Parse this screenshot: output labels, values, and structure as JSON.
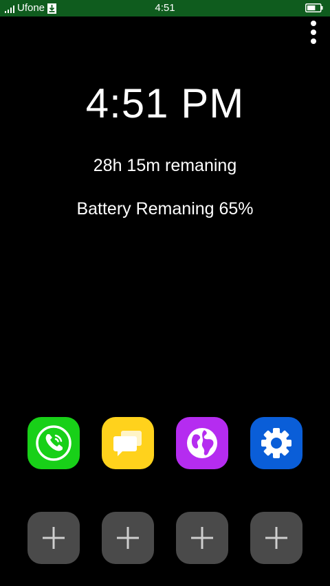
{
  "status_bar": {
    "carrier": "Ufone",
    "time": "4:51",
    "signal_icon": "signal-bars-icon",
    "download_icon": "download-icon",
    "battery_icon": "battery-icon",
    "background": "#0f5c1e"
  },
  "menu": {
    "icon": "overflow-menu-icon"
  },
  "clock": {
    "time": "4:51 PM"
  },
  "battery_info": {
    "time_remaining": "28h 15m remaning",
    "battery_text": "Battery Remaning 65%",
    "level_percent": 65
  },
  "apps": [
    {
      "name": "Phone",
      "icon": "phone-icon",
      "color": "#18d018"
    },
    {
      "name": "Messages",
      "icon": "messages-icon",
      "color": "#ffd21c"
    },
    {
      "name": "Browser",
      "icon": "globe-icon",
      "color": "#b52cf0"
    },
    {
      "name": "Settings",
      "icon": "gear-icon",
      "color": "#0a5ed8"
    }
  ],
  "add_slots": [
    {
      "icon": "plus-icon"
    },
    {
      "icon": "plus-icon"
    },
    {
      "icon": "plus-icon"
    },
    {
      "icon": "plus-icon"
    }
  ]
}
